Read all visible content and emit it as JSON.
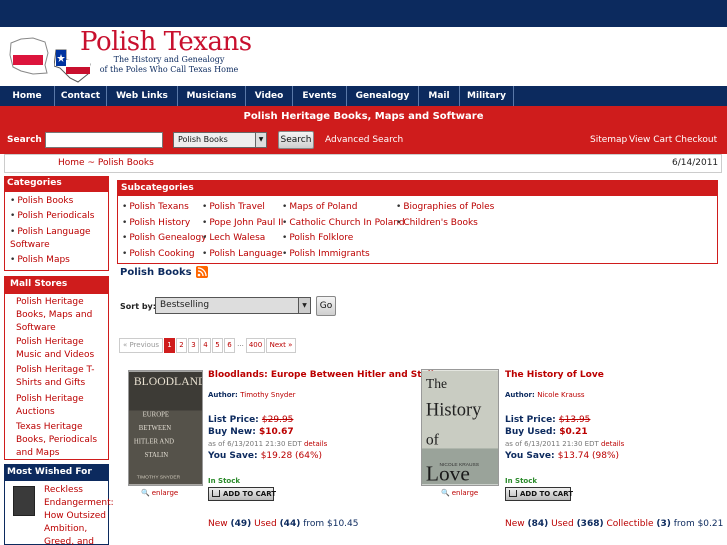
{
  "header": {
    "site_title": "Polish Texans",
    "tagline_line1": "The History and Genealogy",
    "tagline_line2": "of the Poles Who Call Texas Home"
  },
  "nav": [
    "Home",
    "Contact",
    "Web Links",
    "Musicians",
    "Video",
    "Events",
    "Genealogy",
    "Mail",
    "Military"
  ],
  "banner": {
    "title": "Polish Heritage Books, Maps and Software"
  },
  "search": {
    "label": "Search",
    "value": "",
    "category": "Polish Books",
    "button": "Search",
    "advanced": "Advanced Search"
  },
  "toplinks": {
    "sitemap": "Sitemap",
    "cart": "View Cart",
    "checkout": "Checkout"
  },
  "breadcrumb": {
    "home": "Home",
    "sep": "~",
    "current": "Polish Books"
  },
  "date": "6/14/2011",
  "categories": {
    "title": "Categories",
    "items": [
      "Polish Books",
      "Polish Periodicals",
      "Polish Language Software",
      "Polish Maps"
    ]
  },
  "mall": {
    "title": "Mall Stores",
    "items": [
      "Polish Heritage Books, Maps and Software",
      "Polish Heritage Music and Videos",
      "Polish Heritage T-Shirts and Gifts",
      "Polish Heritage Auctions",
      "Texas Heritage Books, Periodicals and Maps"
    ]
  },
  "most_wished": {
    "title": "Most Wished For",
    "item_title": "Reckless Endangerment: How Outsized Ambition, Greed, and"
  },
  "subcategories": {
    "title": "Subcategories",
    "col1": [
      "Polish Texans",
      "Polish History",
      "Polish Genealogy",
      "Polish Cooking"
    ],
    "col2": [
      "Polish Travel",
      "Pope John Paul II",
      "Lech Walesa",
      "Polish Language"
    ],
    "col3": [
      "Maps of Poland",
      "Catholic Church In Poland",
      "Polish Folklore",
      "Polish Immigrants"
    ],
    "col4": [
      "Biographies of Poles",
      "Children's Books"
    ]
  },
  "listing": {
    "title": "Polish Books",
    "sort_label": "Sort by:",
    "sort_value": "Bestselling",
    "go_button": "Go"
  },
  "pagination": {
    "prev": "« Previous",
    "pages": [
      "1",
      "2",
      "3",
      "4",
      "5",
      "6"
    ],
    "dots": "...",
    "last": "400",
    "next": "Next »"
  },
  "books": [
    {
      "title": "Bloodlands: Europe Between Hitler and Stalin",
      "author_label": "Author:",
      "author": "Timothy Snyder",
      "list_label": "List Price:",
      "list_price": "$29.95",
      "buy_label": "Buy New:",
      "buy_price": "$10.67",
      "asof": "as of 6/13/2011 21:30 EDT",
      "details": "details",
      "save_label": "You Save:",
      "save": "$19.28 (64%)",
      "stock": "In Stock",
      "cart": "ADD TO CART",
      "enlarge": "enlarge",
      "new_label": "New",
      "new_count": "(49)",
      "used_label": "Used",
      "used_count": "(44)",
      "from": "from $10.45"
    },
    {
      "title": "The History of Love",
      "author_label": "Author:",
      "author": "Nicole Krauss",
      "list_label": "List Price:",
      "list_price": "$13.95",
      "buy_label": "Buy Used:",
      "buy_price": "$0.21",
      "asof": "as of 6/13/2011 21:30 EDT",
      "details": "details",
      "save_label": "You Save:",
      "save": "$13.74 (98%)",
      "stock": "In Stock",
      "cart": "ADD TO CART",
      "enlarge": "enlarge",
      "new_label": "New",
      "new_count": "(84)",
      "used_label": "Used",
      "used_count": "(368)",
      "collectible_label": "Collectible",
      "collectible_count": "(3)",
      "from": "from $0.21"
    }
  ],
  "colors": {
    "navy": "#0c2a5e",
    "red": "#cf1c1c"
  }
}
